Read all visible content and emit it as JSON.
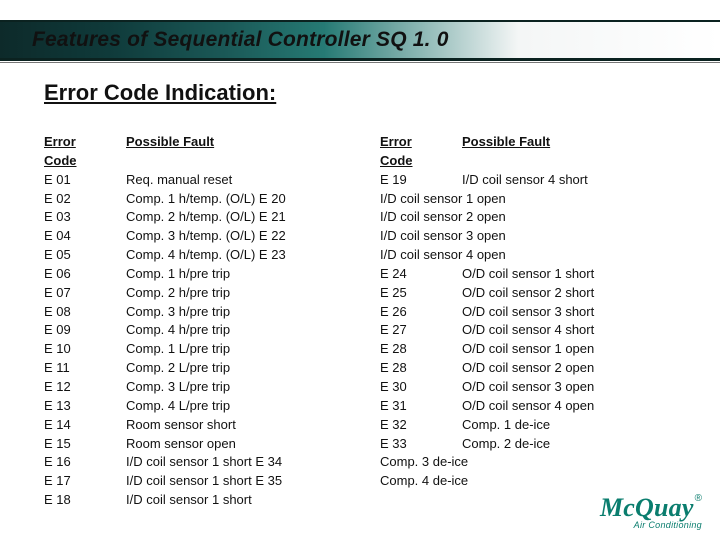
{
  "title": "Features of Sequential Controller SQ 1. 0",
  "section_heading": "Error Code Indication:",
  "headers": {
    "code": "Error Code",
    "fault": "Possible Fault"
  },
  "left_col": [
    {
      "code": "E 01",
      "fault": "Req. manual reset"
    },
    {
      "code": "E 02",
      "fault": "Comp. 1 h/temp. (O/L)  E 20"
    },
    {
      "code": "E 03",
      "fault": "Comp. 2 h/temp. (O/L)  E 21"
    },
    {
      "code": "E 04",
      "fault": "Comp. 3 h/temp. (O/L)  E 22"
    },
    {
      "code": "E 05",
      "fault": "Comp. 4 h/temp. (O/L)  E 23"
    },
    {
      "code": "E 06",
      "fault": "Comp. 1 h/pre trip"
    },
    {
      "code": "E 07",
      "fault": "Comp. 2 h/pre trip"
    },
    {
      "code": "E 08",
      "fault": "Comp. 3 h/pre trip"
    },
    {
      "code": "E 09",
      "fault": "Comp. 4 h/pre trip"
    },
    {
      "code": "E 10",
      "fault": "Comp. 1 L/pre trip"
    },
    {
      "code": "E 11",
      "fault": "Comp. 2 L/pre trip"
    },
    {
      "code": "E 12",
      "fault": "Comp. 3 L/pre trip"
    },
    {
      "code": "E 13",
      "fault": "Comp. 4 L/pre trip"
    },
    {
      "code": "E 14",
      "fault": "Room sensor short"
    },
    {
      "code": "E 15",
      "fault": "Room sensor open"
    },
    {
      "code": "E 16",
      "fault": "I/D coil sensor 1 short  E 34"
    },
    {
      "code": "E 17",
      "fault": " I/D coil sensor 1 short E 35"
    },
    {
      "code": "E 18",
      "fault": "I/D coil sensor 1 short"
    }
  ],
  "right_col": [
    {
      "code": "E 19",
      "fault": "I/D coil sensor 4 short"
    },
    {
      "code": "",
      "fault": "I/D coil sensor 1 open",
      "code_wrap": true
    },
    {
      "code": "",
      "fault": "I/D coil sensor 2 open",
      "code_wrap": true
    },
    {
      "code": "",
      "fault": "I/D coil sensor 3 open",
      "code_wrap": true
    },
    {
      "code": "",
      "fault": "I/D coil sensor 4 open",
      "code_wrap": true
    },
    {
      "code": "E 24",
      "fault": "O/D coil sensor 1 short"
    },
    {
      "code": "E 25",
      "fault": "O/D coil sensor 2 short"
    },
    {
      "code": "E 26",
      "fault": "O/D coil sensor 3 short"
    },
    {
      "code": "E 27",
      "fault": "O/D coil sensor 4 short"
    },
    {
      "code": "E 28",
      "fault": "O/D coil sensor 1 open"
    },
    {
      "code": "E 28",
      "fault": "O/D coil sensor 2 open"
    },
    {
      "code": "E 30",
      "fault": "O/D coil sensor 3 open"
    },
    {
      "code": "E 31",
      "fault": "O/D coil sensor 4 open"
    },
    {
      "code": "E 32",
      "fault": "Comp. 1 de-ice"
    },
    {
      "code": "E 33",
      "fault": "Comp. 2 de-ice"
    },
    {
      "code": "",
      "fault": "Comp. 3 de-ice",
      "code_wrap": true
    },
    {
      "code": "",
      "fault": "Comp. 4 de-ice",
      "code_wrap": true
    }
  ],
  "logo": {
    "main": "McQuay",
    "reg": "®",
    "sub": "Air Conditioning"
  }
}
